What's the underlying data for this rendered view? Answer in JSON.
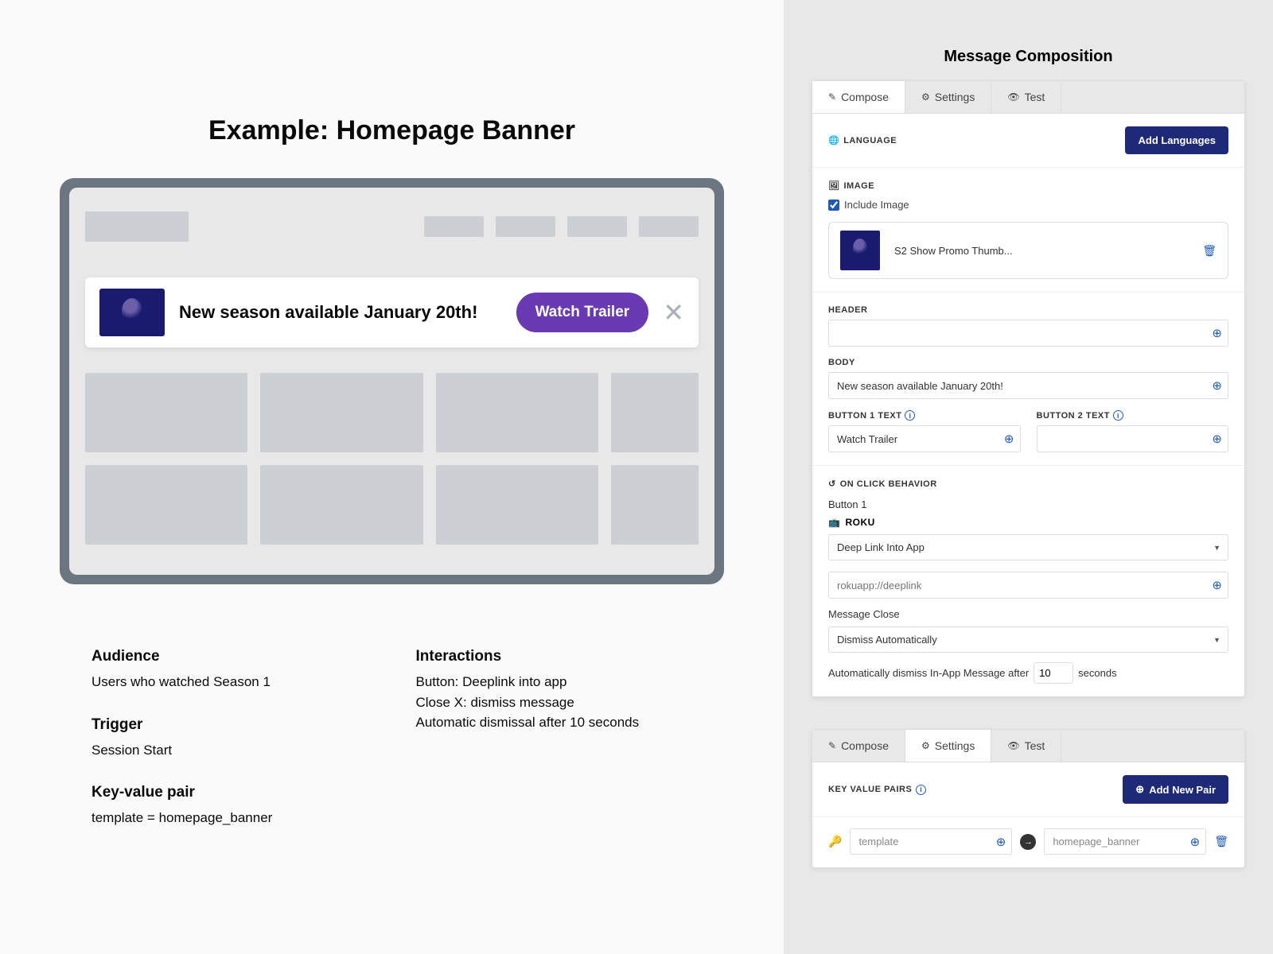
{
  "example": {
    "title": "Example: Homepage Banner",
    "banner_text": "New season available January 20th!",
    "banner_button": "Watch Trailer"
  },
  "meta": {
    "audience_label": "Audience",
    "audience_text": "Users who watched Season 1",
    "trigger_label": "Trigger",
    "trigger_text": "Session Start",
    "kvp_label": "Key-value pair",
    "kvp_text": "template = homepage_banner",
    "interactions_label": "Interactions",
    "interaction_1": "Button: Deeplink into app",
    "interaction_2": "Close X: dismiss message",
    "interaction_3": "Automatic dismissal after 10 seconds"
  },
  "panel": {
    "title": "Message Composition",
    "tabs": {
      "compose": "Compose",
      "settings": "Settings",
      "test": "Test"
    },
    "language": {
      "label": "LANGUAGE",
      "add_button": "Add Languages"
    },
    "image": {
      "label": "IMAGE",
      "include_label": "Include Image",
      "include_checked": true,
      "filename": "S2 Show Promo Thumb..."
    },
    "header": {
      "label": "HEADER",
      "value": ""
    },
    "body": {
      "label": "BODY",
      "value": "New season available January 20th!"
    },
    "button1": {
      "label": "BUTTON 1 TEXT",
      "value": "Watch Trailer"
    },
    "button2": {
      "label": "BUTTON 2 TEXT",
      "value": ""
    },
    "onclick": {
      "label": "ON CLICK BEHAVIOR",
      "button1_label": "Button 1",
      "platform": "ROKU",
      "action": "Deep Link Into App",
      "deeplink_placeholder": "rokuapp://deeplink",
      "close_label": "Message Close",
      "close_action": "Dismiss Automatically",
      "dismiss_prefix": "Automatically dismiss In-App Message after",
      "dismiss_seconds": "10",
      "dismiss_suffix": "seconds"
    },
    "kvp": {
      "label": "KEY VALUE PAIRS",
      "add_button": "Add New Pair",
      "key": "template",
      "value": "homepage_banner"
    }
  }
}
